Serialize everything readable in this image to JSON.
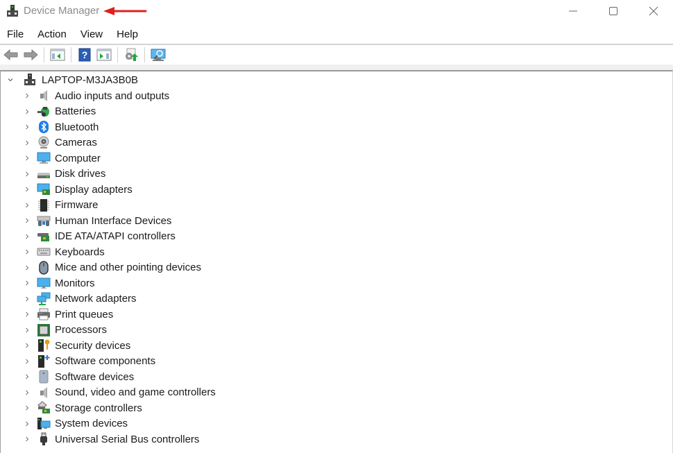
{
  "window": {
    "title": "Device Manager",
    "app_icon": "device-manager-icon",
    "annotation": "red-arrow-pointing-left",
    "annotation_color": "#e02020",
    "controls": [
      "minimize",
      "maximize",
      "close"
    ]
  },
  "menu": {
    "items": [
      {
        "label": "File"
      },
      {
        "label": "Action"
      },
      {
        "label": "View"
      },
      {
        "label": "Help"
      }
    ]
  },
  "toolbar": {
    "buttons": [
      {
        "name": "back",
        "icon": "arrow-left-icon"
      },
      {
        "name": "forward",
        "icon": "arrow-right-icon"
      },
      {
        "name": "show-hide-console-tree",
        "icon": "console-tree-icon"
      },
      {
        "name": "help",
        "icon": "help-icon"
      },
      {
        "name": "show-hide-action-pane",
        "icon": "action-pane-icon"
      },
      {
        "name": "update-driver",
        "icon": "update-driver-icon"
      },
      {
        "name": "scan-for-hardware-changes",
        "icon": "scan-hardware-icon"
      }
    ]
  },
  "tree": {
    "root": {
      "label": "LAPTOP-M3JA3B0B",
      "expanded": true
    },
    "categories": [
      {
        "label": "Audio inputs and outputs",
        "icon": "speaker-icon"
      },
      {
        "label": "Batteries",
        "icon": "battery-icon"
      },
      {
        "label": "Bluetooth",
        "icon": "bluetooth-icon"
      },
      {
        "label": "Cameras",
        "icon": "camera-icon"
      },
      {
        "label": "Computer",
        "icon": "computer-icon"
      },
      {
        "label": "Disk drives",
        "icon": "disk-drive-icon"
      },
      {
        "label": "Display adapters",
        "icon": "display-adapter-icon"
      },
      {
        "label": "Firmware",
        "icon": "firmware-chip-icon"
      },
      {
        "label": "Human Interface Devices",
        "icon": "hid-icon"
      },
      {
        "label": "IDE ATA/ATAPI controllers",
        "icon": "ide-controller-icon"
      },
      {
        "label": "Keyboards",
        "icon": "keyboard-icon"
      },
      {
        "label": "Mice and other pointing devices",
        "icon": "mouse-icon"
      },
      {
        "label": "Monitors",
        "icon": "monitor-icon"
      },
      {
        "label": "Network adapters",
        "icon": "network-adapter-icon"
      },
      {
        "label": "Print queues",
        "icon": "printer-icon"
      },
      {
        "label": "Processors",
        "icon": "processor-icon"
      },
      {
        "label": "Security devices",
        "icon": "security-device-icon"
      },
      {
        "label": "Software components",
        "icon": "software-component-icon"
      },
      {
        "label": "Software devices",
        "icon": "software-device-icon"
      },
      {
        "label": "Sound, video and game controllers",
        "icon": "sound-controller-icon"
      },
      {
        "label": "Storage controllers",
        "icon": "storage-controller-icon"
      },
      {
        "label": "System devices",
        "icon": "system-devices-icon"
      },
      {
        "label": "Universal Serial Bus controllers",
        "icon": "usb-icon"
      }
    ]
  }
}
